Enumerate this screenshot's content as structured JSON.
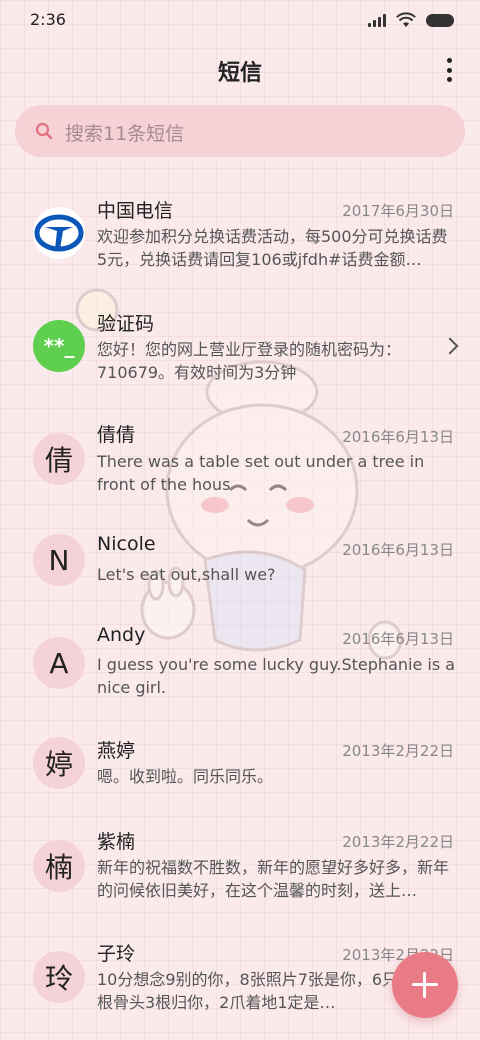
{
  "status": {
    "time": "2:36"
  },
  "header": {
    "title": "短信"
  },
  "search": {
    "placeholder": "搜索11条短信"
  },
  "messages": [
    {
      "name": "中国电信",
      "date": "2017年6月30日",
      "preview": "欢迎参加积分兑换话费活动，每500分可兑换话费5元，兑换话费请回复106或jfdh#话费金额…",
      "avatar_icon": "china-telecom-logo"
    },
    {
      "name": "验证码",
      "date": "",
      "preview": "您好！您的网上营业厅登录的随机密码为：710679。有效时间为3分钟",
      "avatar_text": "**_"
    },
    {
      "name": "倩倩",
      "date": "2016年6月13日",
      "preview": "There was a table set out under a tree in front of the hous",
      "avatar_text": "倩"
    },
    {
      "name": "Nicole",
      "date": "2016年6月13日",
      "preview": "Let's eat out,shall we?",
      "avatar_text": "N"
    },
    {
      "name": "Andy",
      "date": "2016年6月13日",
      "preview": "I guess you're some lucky guy.Stephanie is a nice girl.",
      "avatar_text": "A"
    },
    {
      "name": "燕婷",
      "date": "2013年2月22日",
      "preview": "嗯。收到啦。同乐同乐。",
      "avatar_text": "婷"
    },
    {
      "name": "紫楠",
      "date": "2013年2月22日",
      "preview": "新年的祝福数不胜数，新年的愿望好多好多，新年的问候依旧美好，在这个温馨的时刻，送上…",
      "avatar_text": "楠"
    },
    {
      "name": "子玲",
      "date": "2013年2月22日",
      "preview": "10分想念9别的你，8张照片7张是你，6只像你，4根骨头3根归你，2爪着地1定是…",
      "avatar_text": "玲"
    }
  ],
  "colors": {
    "accent": "#e87b86",
    "background": "#fbeaec",
    "search_bg": "#f6d1d6",
    "verify_green": "#5fcf4f"
  }
}
